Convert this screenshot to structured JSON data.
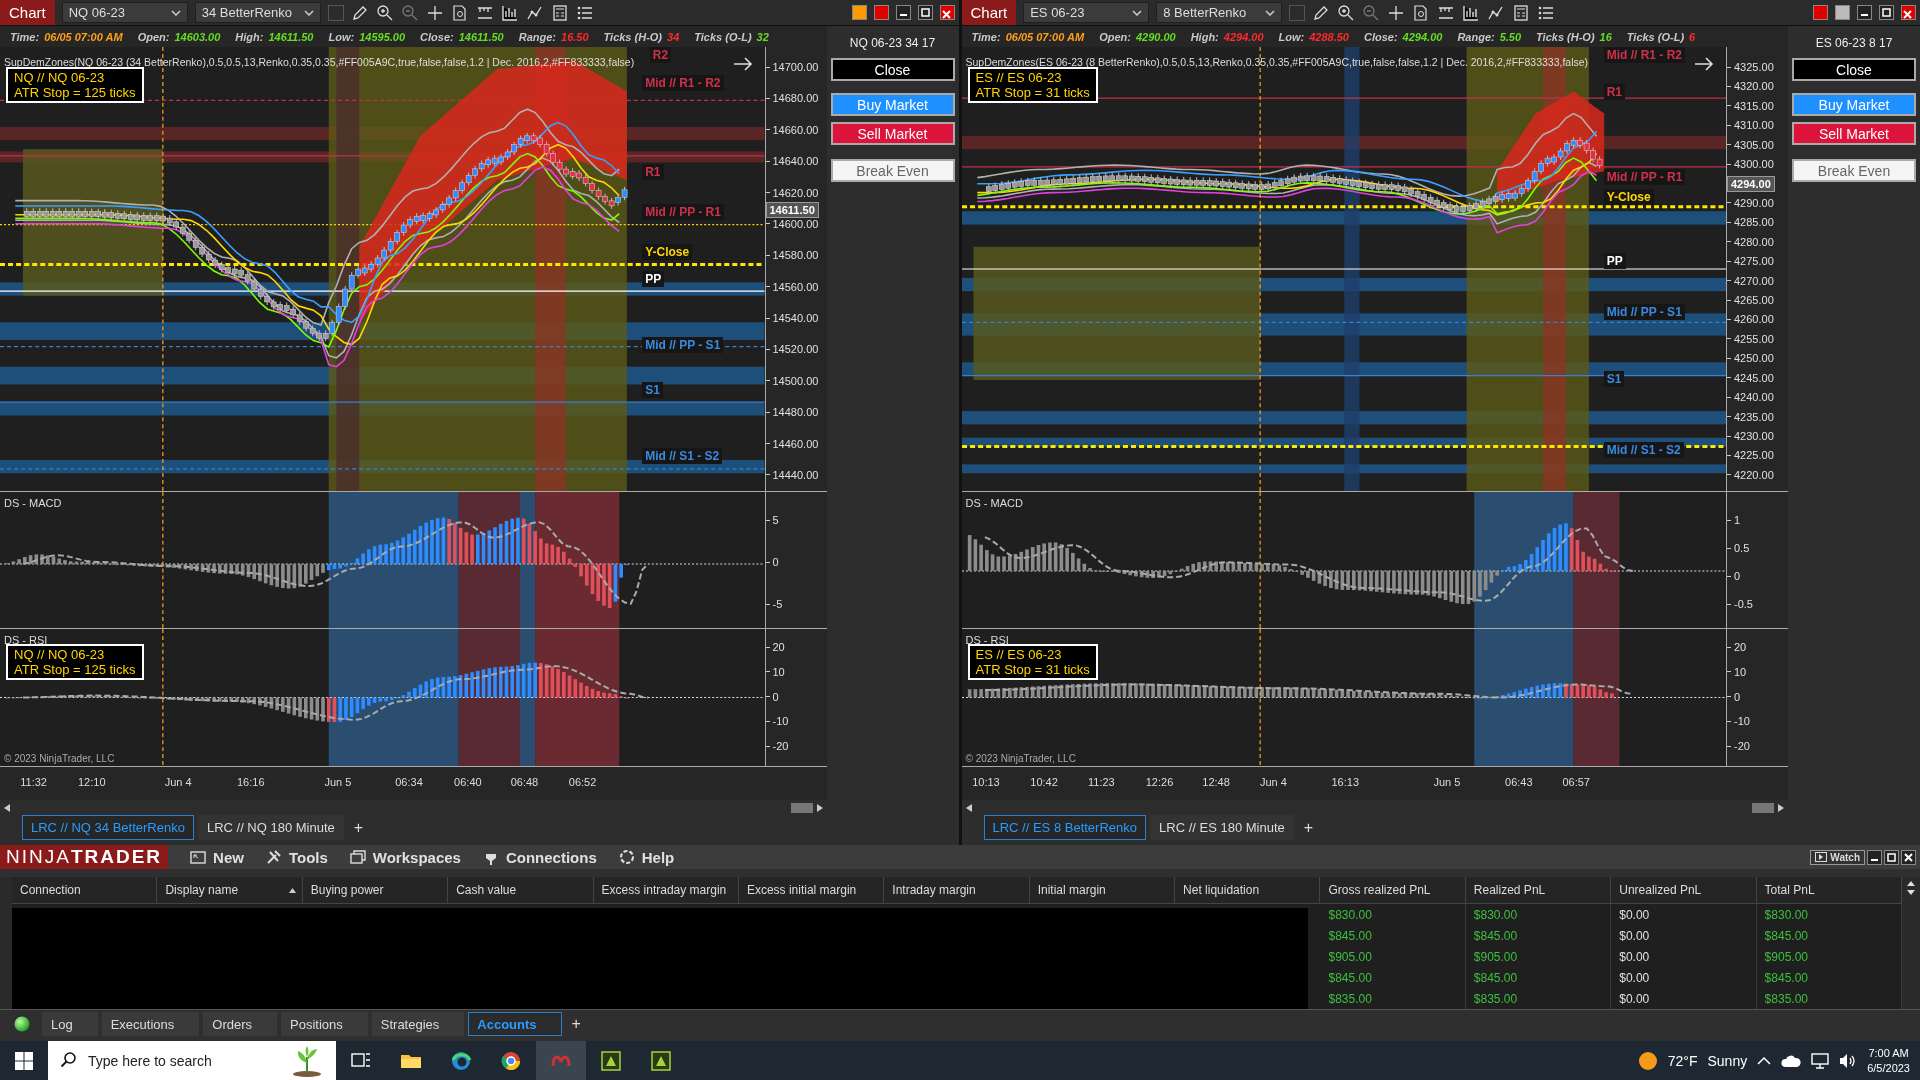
{
  "charts": [
    {
      "title": "Chart",
      "instrument": "NQ 06-23",
      "bar_type": "34 BetterRenko",
      "info": [
        {
          "label": "Time:",
          "value": "06/05 07:00 AM",
          "color": "#ff9f1a"
        },
        {
          "label": "Open:",
          "value": "14603.00",
          "color": "#66dd22"
        },
        {
          "label": "High:",
          "value": "14611.50",
          "color": "#66dd22"
        },
        {
          "label": "Low:",
          "value": "14595.00",
          "color": "#66dd22"
        },
        {
          "label": "Close:",
          "value": "14611.50",
          "color": "#66dd22"
        },
        {
          "label": "Range:",
          "value": "16.50",
          "color": "#ff2a2a"
        },
        {
          "label": "Ticks (H-O)",
          "value": "34",
          "color": "#ff2a2a"
        },
        {
          "label": "Ticks (O-L)",
          "value": "32",
          "color": "#66dd22"
        }
      ],
      "indicator_text": "SupDemZones(NQ 06-23 (34 BetterRenko),0.5,0.5,13,Renko,0.35,0.35,#FF005A9C,true,false,false,1.2 | Dec. 2016,2,#FF833333,false)",
      "legend": [
        "NQ // NQ 06-23",
        "ATR Stop = 125 ticks"
      ],
      "levels": [
        {
          "label": "R2",
          "color": "#d0304a"
        },
        {
          "label": "Mid // R1 - R2",
          "color": "#d0304a"
        },
        {
          "label": "R1",
          "color": "#d0304a"
        },
        {
          "label": "Mid // PP - R1",
          "color": "#d0304a"
        },
        {
          "label": "Y-Close",
          "color": "#ffd700"
        },
        {
          "label": "PP",
          "color": "#ffffff"
        },
        {
          "label": "Mid // PP - S1",
          "color": "#3a8ae0"
        },
        {
          "label": "S1",
          "color": "#3a8ae0"
        },
        {
          "label": "Mid // S1 - S2",
          "color": "#3a8ae0"
        }
      ],
      "price_ticks": [
        "14700.00",
        "14680.00",
        "14660.00",
        "14640.00",
        "14620.00",
        "14600.00",
        "14580.00",
        "14560.00",
        "14540.00",
        "14520.00",
        "14500.00",
        "14480.00",
        "14460.00",
        "14440.00"
      ],
      "last_price": "14611.50",
      "macd": {
        "title": "DS - MACD",
        "ticks": [
          "5",
          "0",
          "-5"
        ]
      },
      "rsi": {
        "title": "DS - RSI",
        "ticks": [
          "20",
          "10",
          "0",
          "-10",
          "-20"
        ],
        "legend": [
          "NQ // NQ 06-23",
          "ATR Stop = 125 ticks"
        ]
      },
      "copyright": "© 2023 NinjaTrader, LLC",
      "time_ticks": [
        "11:32",
        "12:10",
        "Jun 4",
        "16:16",
        "Jun 5",
        "06:34",
        "06:40",
        "06:48",
        "06:52"
      ],
      "side_panel": {
        "title": "NQ 06-23 34 17",
        "buttons": [
          {
            "label": "Close",
            "kind": "close"
          },
          {
            "label": "Buy Market",
            "kind": "buy"
          },
          {
            "label": "Sell Market",
            "kind": "sell"
          },
          {
            "label": "Break Even",
            "kind": "neutral"
          }
        ]
      },
      "tabs": [
        {
          "label": "LRC // NQ 34 BetterRenko",
          "selected": true
        },
        {
          "label": "LRC // NQ 180 Minute",
          "selected": false
        }
      ],
      "add_tab": "+"
    },
    {
      "title": "Chart",
      "instrument": "ES 06-23",
      "bar_type": "8 BetterRenko",
      "info": [
        {
          "label": "Time:",
          "value": "06/05 07:00 AM",
          "color": "#ff9f1a"
        },
        {
          "label": "Open:",
          "value": "4290.00",
          "color": "#66dd22"
        },
        {
          "label": "High:",
          "value": "4294.00",
          "color": "#ff2a2a"
        },
        {
          "label": "Low:",
          "value": "4288.50",
          "color": "#ff2a2a"
        },
        {
          "label": "Close:",
          "value": "4294.00",
          "color": "#66dd22"
        },
        {
          "label": "Range:",
          "value": "5.50",
          "color": "#66dd22"
        },
        {
          "label": "Ticks (H-O)",
          "value": "16",
          "color": "#66dd22"
        },
        {
          "label": "Ticks (O-L)",
          "value": "6",
          "color": "#ff2a2a"
        }
      ],
      "indicator_text": "SupDemZones(ES 06-23 (8 BetterRenko),0.5,0.5,13,Renko,0.35,0.35,#FF005A9C,true,false,false,1.2 | Dec. 2016,2,#FF833333,false)",
      "legend": [
        "ES // ES 06-23",
        "ATR Stop = 31 ticks"
      ],
      "levels": [
        {
          "label": "Mid // R1 - R2",
          "color": "#d0304a"
        },
        {
          "label": "R1",
          "color": "#d0304a"
        },
        {
          "label": "Mid // PP - R1",
          "color": "#d0304a"
        },
        {
          "label": "Y-Close",
          "color": "#ffd700"
        },
        {
          "label": "PP",
          "color": "#ffffff"
        },
        {
          "label": "Mid // PP - S1",
          "color": "#3a8ae0"
        },
        {
          "label": "S1",
          "color": "#3a8ae0"
        },
        {
          "label": "Mid // S1 - S2",
          "color": "#3a8ae0"
        }
      ],
      "price_ticks": [
        "4325.00",
        "4320.00",
        "4315.00",
        "4310.00",
        "4305.00",
        "4300.00",
        "4290.00",
        "4285.00",
        "4280.00",
        "4275.00",
        "4270.00",
        "4265.00",
        "4260.00",
        "4255.00",
        "4250.00",
        "4245.00",
        "4240.00",
        "4235.00",
        "4230.00",
        "4225.00",
        "4220.00"
      ],
      "last_price": "4294.00",
      "macd": {
        "title": "DS - MACD",
        "ticks": [
          "1",
          "0.5",
          "0",
          "-0.5"
        ]
      },
      "rsi": {
        "title": "DS - RSI",
        "ticks": [
          "20",
          "10",
          "0",
          "-10",
          "-20"
        ],
        "legend": [
          "ES // ES 06-23",
          "ATR Stop = 31 ticks"
        ]
      },
      "copyright": "© 2023 NinjaTrader, LLC",
      "time_ticks": [
        "10:13",
        "10:42",
        "11:23",
        "12:26",
        "12:48",
        "Jun 4",
        "16:13",
        "Jun 5",
        "06:43",
        "06:57"
      ],
      "side_panel": {
        "title": "ES 06-23 8 17",
        "buttons": [
          {
            "label": "Close",
            "kind": "close"
          },
          {
            "label": "Buy Market",
            "kind": "buy"
          },
          {
            "label": "Sell Market",
            "kind": "sell"
          },
          {
            "label": "Break Even",
            "kind": "neutral"
          }
        ]
      },
      "tabs": [
        {
          "label": "LRC // ES 8 BetterRenko",
          "selected": true
        },
        {
          "label": "LRC // ES 180 Minute",
          "selected": false
        }
      ],
      "add_tab": "+"
    }
  ],
  "control_center": {
    "logo_light": "NINJA",
    "logo_bold": "TRADER",
    "menu": [
      "New",
      "Tools",
      "Workspaces",
      "Connections",
      "Help"
    ],
    "watch_button": "Watch",
    "columns": [
      "Connection",
      "Display name",
      "Buying power",
      "Cash value",
      "Excess intraday margin",
      "Excess initial margin",
      "Intraday margin",
      "Initial margin",
      "Net liquidation",
      "Gross realized PnL",
      "Realized PnL",
      "Unrealized PnL",
      "Total PnL"
    ],
    "rows": [
      [
        {
          "value": "$830.00",
          "color": "#3cc03c"
        },
        {
          "value": "$830.00",
          "color": "#3cc03c"
        },
        {
          "value": "$0.00",
          "color": "#e0e0e0"
        },
        {
          "value": "$830.00",
          "color": "#3cc03c"
        }
      ],
      [
        {
          "value": "$845.00",
          "color": "#3cc03c"
        },
        {
          "value": "$845.00",
          "color": "#3cc03c"
        },
        {
          "value": "$0.00",
          "color": "#e0e0e0"
        },
        {
          "value": "$845.00",
          "color": "#3cc03c"
        }
      ],
      [
        {
          "value": "$905.00",
          "color": "#3cc03c"
        },
        {
          "value": "$905.00",
          "color": "#3cc03c"
        },
        {
          "value": "$0.00",
          "color": "#e0e0e0"
        },
        {
          "value": "$905.00",
          "color": "#3cc03c"
        }
      ],
      [
        {
          "value": "$845.00",
          "color": "#3cc03c"
        },
        {
          "value": "$845.00",
          "color": "#3cc03c"
        },
        {
          "value": "$0.00",
          "color": "#e0e0e0"
        },
        {
          "value": "$845.00",
          "color": "#3cc03c"
        }
      ],
      [
        {
          "value": "$835.00",
          "color": "#3cc03c"
        },
        {
          "value": "$835.00",
          "color": "#3cc03c"
        },
        {
          "value": "$0.00",
          "color": "#e0e0e0"
        },
        {
          "value": "$835.00",
          "color": "#3cc03c"
        }
      ]
    ],
    "tabs": [
      {
        "label": "Log",
        "selected": false
      },
      {
        "label": "Executions",
        "selected": false
      },
      {
        "label": "Orders",
        "selected": false
      },
      {
        "label": "Positions",
        "selected": false
      },
      {
        "label": "Strategies",
        "selected": false
      },
      {
        "label": "Accounts",
        "selected": true
      }
    ],
    "add_tab": "+"
  },
  "taskbar": {
    "search": {
      "placeholder": "Type here to search"
    },
    "temperature": "72°F",
    "weather": "Sunny",
    "time": "7:00 AM",
    "date": "6/5/2023"
  }
}
